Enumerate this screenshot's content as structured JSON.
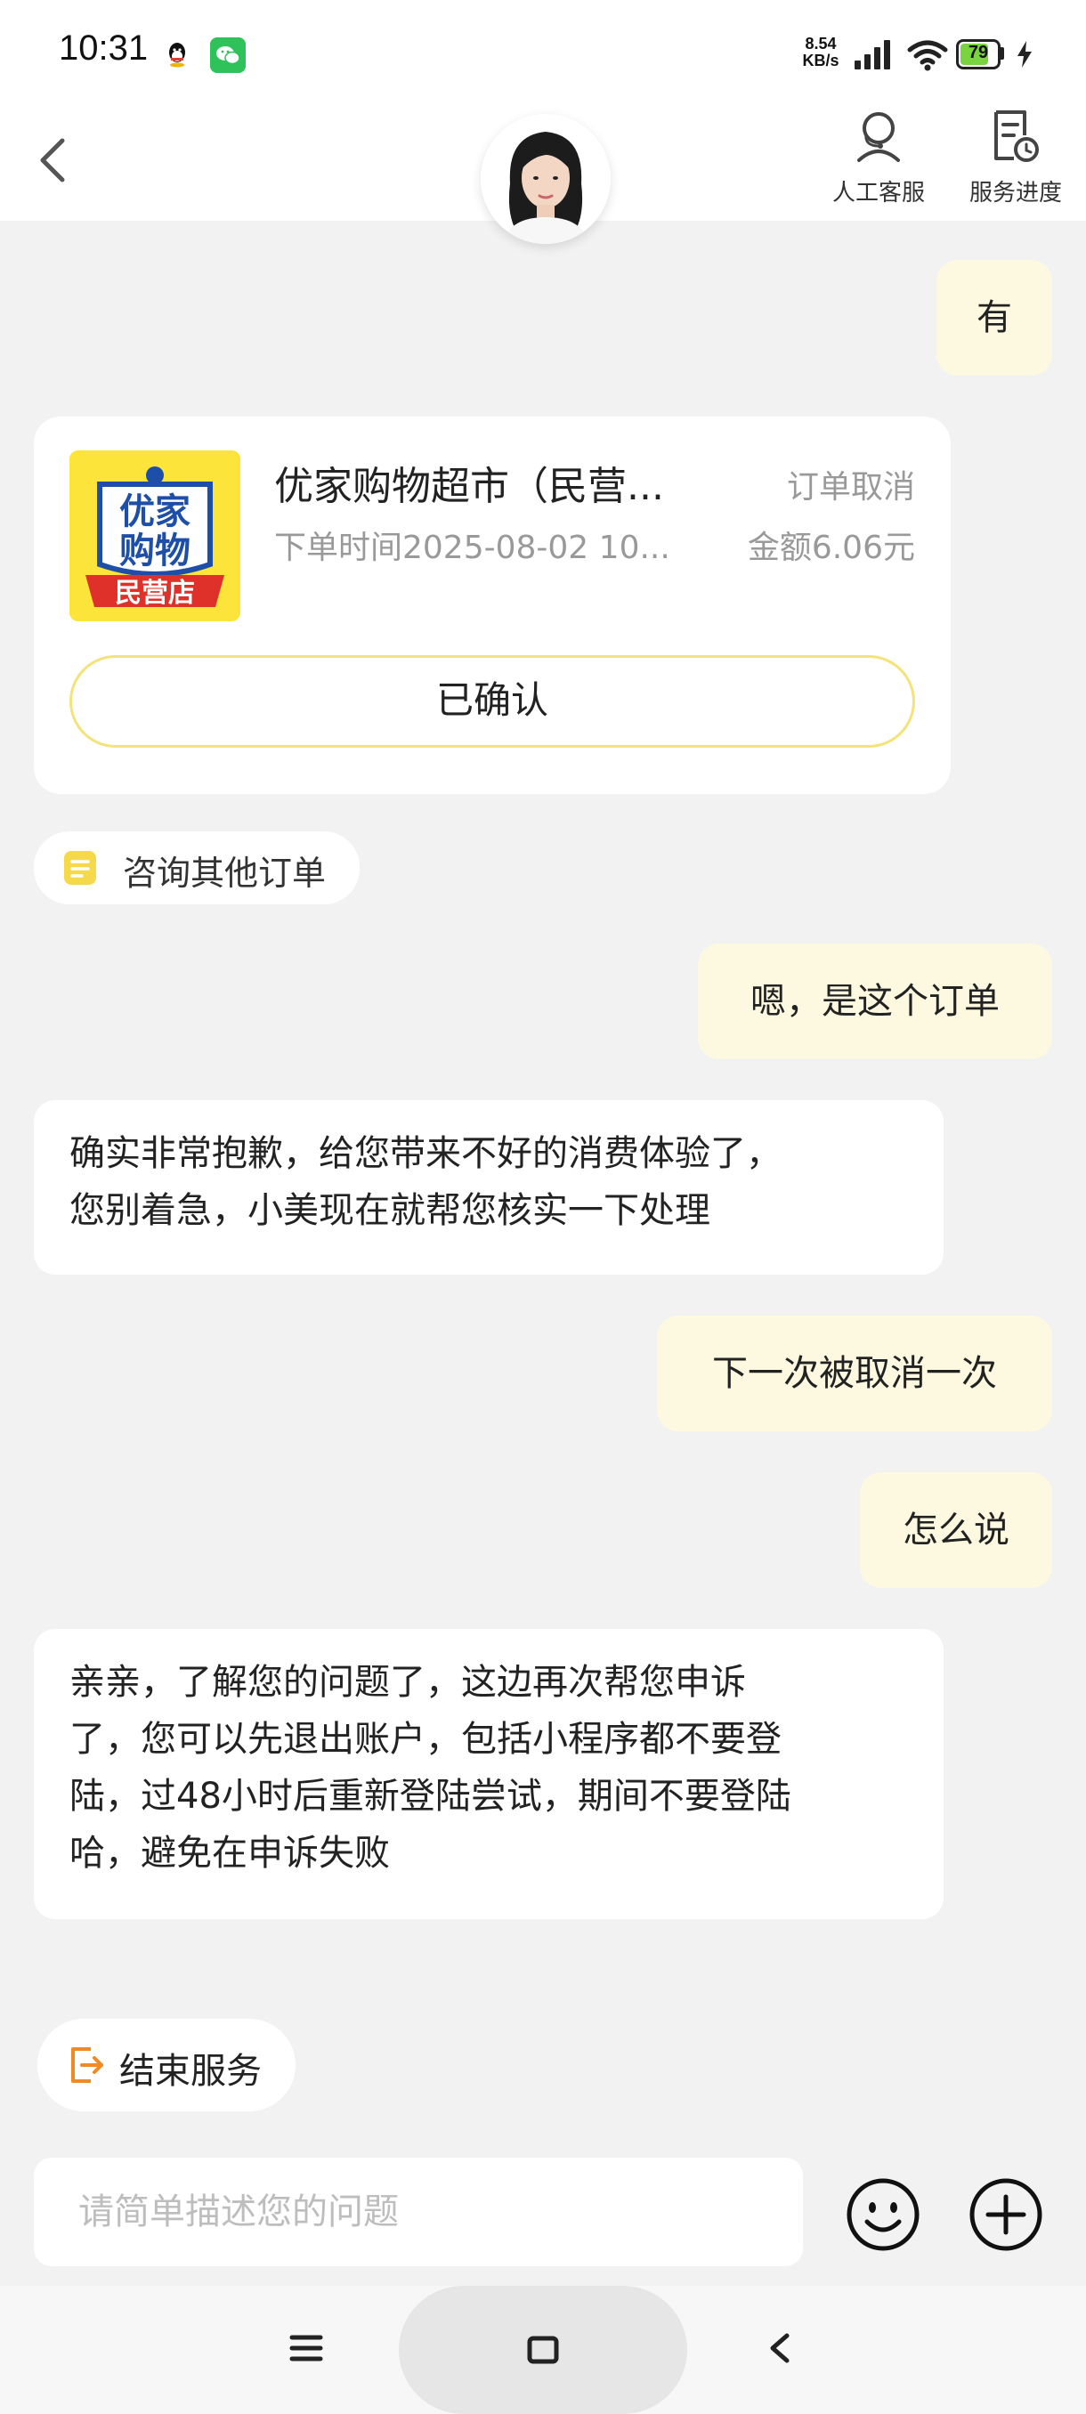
{
  "status_bar": {
    "time": "10:31",
    "net_speed_value": "8.54",
    "net_speed_unit": "KB/s",
    "battery": "79",
    "battery_level": 0.79,
    "icons": [
      "qq-icon",
      "wechat-icon",
      "signal-icon",
      "wifi-icon",
      "battery-icon",
      "charging-icon"
    ]
  },
  "header": {
    "back_icon": "back-arrow-icon",
    "avatar": "agent-avatar",
    "human_service_label": "人工客服",
    "service_progress_label": "服务进度"
  },
  "messages": {
    "user_1": "有",
    "order_card": {
      "shop_name": "优家购物超市（民营...",
      "status": "订单取消",
      "order_time": "下单时间2025-08-02 10...",
      "amount": "金额6.06元",
      "confirm_label": "已确认",
      "logo_lines": [
        "优家",
        "购物",
        "民营店"
      ]
    },
    "consult_other_orders": "咨询其他订单",
    "user_2": "嗯，是这个订单",
    "agent_1_line1": "确实非常抱歉，给您带来不好的消费体验了，",
    "agent_1_line2": "您别着急，小美现在就帮您核实一下处理",
    "user_3": "下一次被取消一次",
    "user_4": "怎么说",
    "agent_2_line1": "亲亲，了解您的问题了，这边再次帮您申诉",
    "agent_2_line2": "了，您可以先退出账户，包括小程序都不要登",
    "agent_2_line3": "陆，过48小时后重新登陆尝试，期间不要登陆",
    "agent_2_line4": "哈，避免在申诉失败"
  },
  "bottom": {
    "end_service_label": "结束服务",
    "input_placeholder": "请简单描述您的问题",
    "emoji_icon": "emoji-icon",
    "plus_icon": "plus-icon"
  },
  "colors": {
    "user_bubble": "#fdf9e1",
    "agent_bubble": "#ffffff",
    "background": "#f2f2f2",
    "accent_yellow": "#fde43b",
    "end_service_orange": "#f08a24"
  }
}
